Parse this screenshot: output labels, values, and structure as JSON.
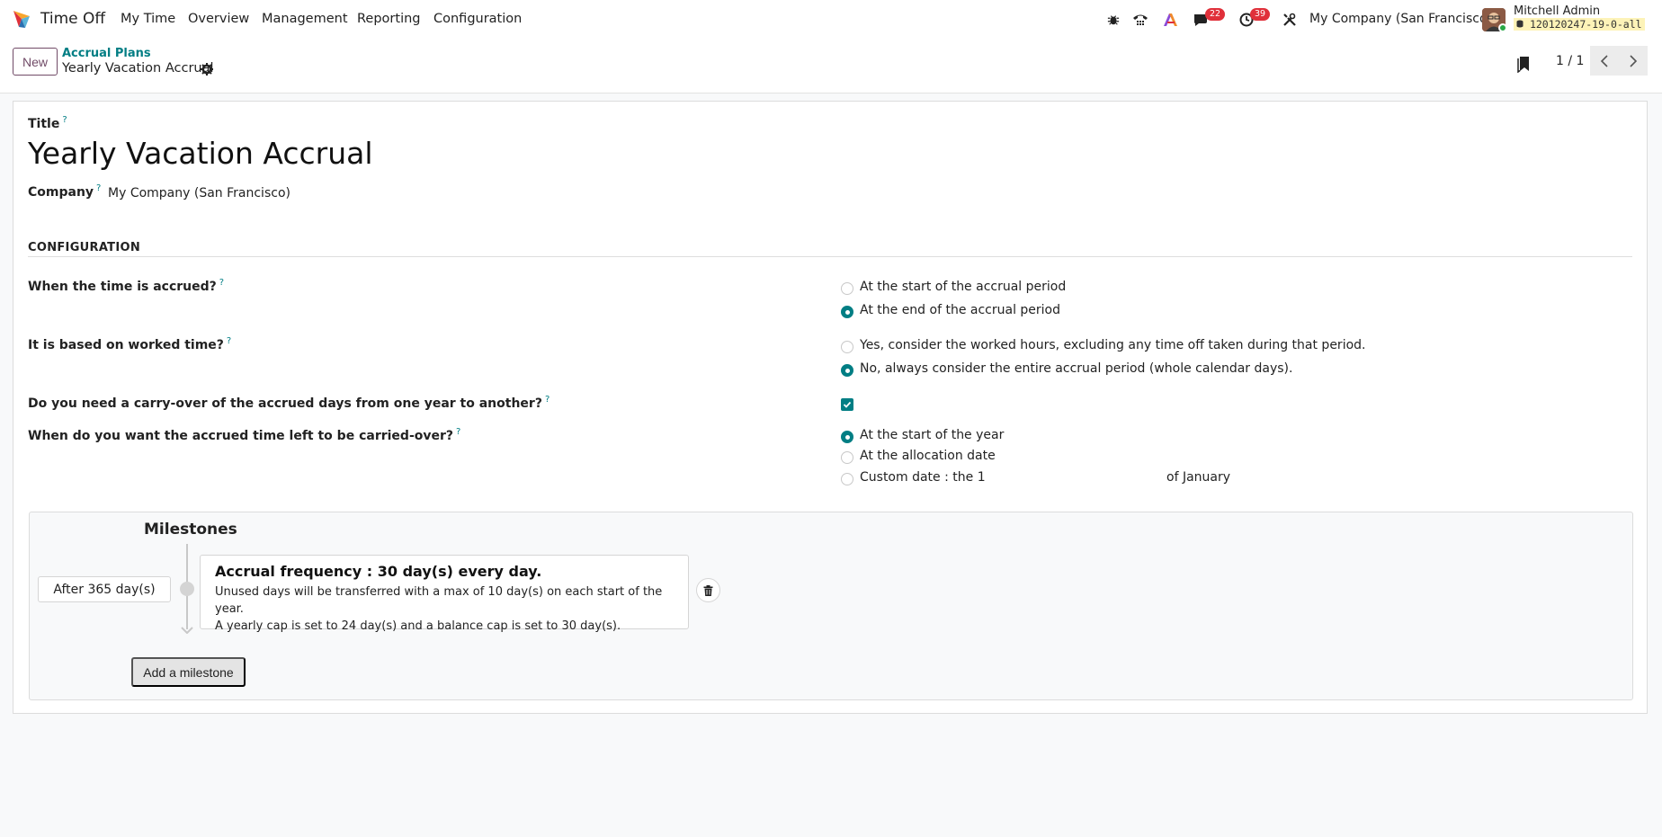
{
  "navbar": {
    "app_name": "Time Off",
    "menu": [
      "My Time",
      "Overview",
      "Management",
      "Reporting",
      "Configuration"
    ],
    "messages_count": "22",
    "activities_count": "39",
    "company": "My Company (San Francisco)",
    "user_name": "Mitchell Admin",
    "db_name": "120120247-19-0-all"
  },
  "control": {
    "new_label": "New",
    "breadcrumb_parent": "Accrual Plans",
    "breadcrumb_current": "Yearly Vacation Accrual",
    "pager": "1 / 1"
  },
  "form": {
    "title_label": "Title",
    "title_value": "Yearly Vacation Accrual",
    "company_label": "Company",
    "company_value": "My Company (San Francisco)",
    "section_title": "CONFIGURATION",
    "q_accrued": "When the time is accrued?",
    "accrued_opt1": "At the start of the accrual period",
    "accrued_opt2": "At the end of the accrual period",
    "q_worked": "It is based on worked time?",
    "worked_opt1": "Yes, consider the worked hours, excluding any time off taken during that period.",
    "worked_opt2": "No, always consider the entire accrual period (whole calendar days).",
    "q_carryover": "Do you need a carry-over of the accrued days from one year to another?",
    "q_carry_when": "When do you want the accrued time left to be carried-over?",
    "carry_opt1": "At the start of the year",
    "carry_opt2": "At the allocation date",
    "carry_opt3": "Custom date : the 1",
    "carry_month": "of January"
  },
  "milestones": {
    "title": "Milestones",
    "after_label": "After 365 day(s)",
    "card_title": "Accrual frequency : 30 day(s) every day.",
    "card_line1": "Unused days will be transferred with a max of 10 day(s) on each start of the year.",
    "card_line2": "A yearly cap is set to 24 day(s) and a balance cap is set to 30 day(s).",
    "add_label": "Add a milestone"
  },
  "colors": {
    "accent": "#017e84",
    "brand": "#714b67",
    "badge": "#e0303a"
  }
}
